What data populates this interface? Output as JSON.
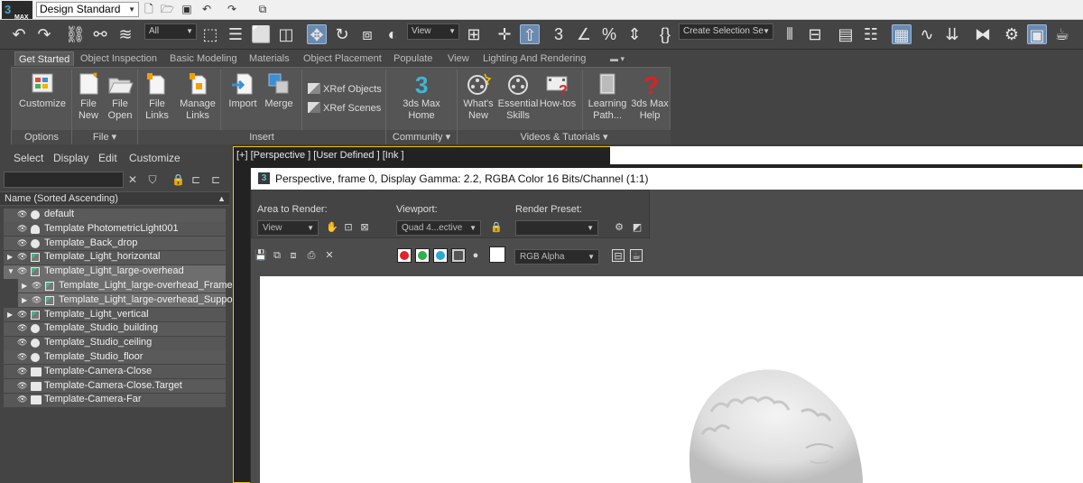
{
  "titlebar": {
    "app_logo_main": "3",
    "app_logo_sub": "MAX",
    "workspace": "Design Standard",
    "icons": [
      "new-file-icon",
      "open-folder-icon",
      "save-icon",
      "undo-icon",
      "redo-icon",
      "project-folder-icon"
    ]
  },
  "main_toolbar": {
    "selection_filter": "All",
    "reference_coord": "View",
    "named_selection": "Create Selection Se"
  },
  "ribbon_tabs": [
    "Get Started",
    "Object Inspection",
    "Basic Modeling",
    "Materials",
    "Object Placement",
    "Populate",
    "View",
    "Lighting And Rendering"
  ],
  "ribbon": {
    "options": {
      "footer": "Options",
      "customize": "Customize"
    },
    "file": {
      "footer": "File ▾",
      "new_l1": "File",
      "new_l2": "New",
      "open_l1": "File",
      "open_l2": "Open"
    },
    "insert": {
      "footer": "Insert",
      "links_l1": "File",
      "links_l2": "Links",
      "manage_l1": "Manage",
      "manage_l2": "Links",
      "import": "Import",
      "merge": "Merge",
      "xref_objects": "XRef Objects",
      "xref_scenes": "XRef Scenes"
    },
    "community": {
      "footer": "Community ▾",
      "home_l1": "3ds Max",
      "home_l2": "Home"
    },
    "videos": {
      "footer": "Videos & Tutorials ▾",
      "whats_new_l1": "What's",
      "whats_new_l2": "New",
      "essential_l1": "Essential",
      "essential_l2": "Skills",
      "howtos": "How-tos",
      "learning_l1": "Learning",
      "learning_l2": "Path...",
      "help_l1": "3ds Max",
      "help_l2": "Help"
    }
  },
  "explorer": {
    "menu": [
      "Select",
      "Display",
      "Edit",
      "Customize"
    ],
    "header": "Name (Sorted Ascending)",
    "rows": [
      {
        "label": "default",
        "level": 0,
        "expander": "",
        "icon": "dot"
      },
      {
        "label": "Template PhotometricLight001",
        "level": 0,
        "expander": "",
        "icon": "light"
      },
      {
        "label": "Template_Back_drop",
        "level": 0,
        "expander": "",
        "icon": "dot"
      },
      {
        "label": "Template_Light_horizontal",
        "level": 0,
        "expander": "▶",
        "icon": "group"
      },
      {
        "label": "Template_Light_large-overhead",
        "level": 0,
        "expander": "▼",
        "icon": "group",
        "selected": true
      },
      {
        "label": "Template_Light_large-overhead_Frame",
        "level": 1,
        "expander": "▶",
        "icon": "group",
        "selected": true
      },
      {
        "label": "Template_Light_large-overhead_Support",
        "level": 1,
        "expander": "▶",
        "icon": "group",
        "selected": true
      },
      {
        "label": "Template_Light_vertical",
        "level": 0,
        "expander": "▶",
        "icon": "group"
      },
      {
        "label": "Template_Studio_building",
        "level": 0,
        "expander": "",
        "icon": "dot"
      },
      {
        "label": "Template_Studio_ceiling",
        "level": 0,
        "expander": "",
        "icon": "dot"
      },
      {
        "label": "Template_Studio_floor",
        "level": 0,
        "expander": "",
        "icon": "dot"
      },
      {
        "label": "Template-Camera-Close",
        "level": 0,
        "expander": "",
        "icon": "camera"
      },
      {
        "label": "Template-Camera-Close.Target",
        "level": 0,
        "expander": "",
        "icon": "camera"
      },
      {
        "label": "Template-Camera-Far",
        "level": 0,
        "expander": "",
        "icon": "camera"
      }
    ]
  },
  "viewport": {
    "label": "[+] [Perspective ] [User Defined ] [Ink ]"
  },
  "render_window": {
    "logo": "3",
    "title": "Perspective, frame 0, Display Gamma: 2.2, RGBA Color 16 Bits/Channel (1:1)",
    "area_label": "Area to Render:",
    "area_value": "View",
    "viewport_label": "Viewport:",
    "viewport_value": "Quad 4...ective",
    "preset_label": "Render Preset:",
    "preset_value": "",
    "channel_value": "RGB Alpha",
    "colors": {
      "red": "#e0242c",
      "green": "#2fb04a",
      "blue": "#29a9d6",
      "accent": "#f2c200"
    }
  }
}
